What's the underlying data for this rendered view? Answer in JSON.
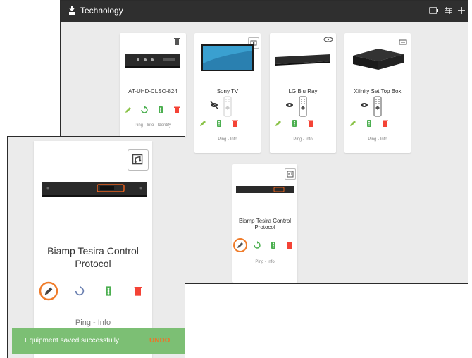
{
  "window": {
    "title": "Technology"
  },
  "equipment": [
    {
      "name": "AT-UHD-CLSO-824",
      "links": "Ping - Info - Identify",
      "badge_icon": "trash-icon"
    },
    {
      "name": "Sony TV",
      "links": "Ping - Info",
      "badge_icon": "play-box-icon"
    },
    {
      "name": "LG Blu Ray",
      "links": "Ping - Info",
      "badge_icon": "disc-player-icon"
    },
    {
      "name": "Xfinity Set Top Box",
      "links": "Ping - Info",
      "badge_icon": "set-top-box-icon"
    },
    {
      "name": "Biamp Tesira Control Protocol",
      "links": "Ping - Info",
      "badge_icon": "audio-processor-icon"
    }
  ],
  "detail": {
    "name_line1": "Biamp Tesira Control",
    "name_line2": "Protocol",
    "links": "Ping - Info"
  },
  "toast": {
    "message": "Equipment saved successfully",
    "action": "UNDO"
  },
  "colors": {
    "topbar": "#2f2f2f",
    "edit": "#8bc34a",
    "refresh": "#4caf50",
    "traffic": "#4caf50",
    "delete": "#f44336",
    "highlight": "#f07c2a",
    "toast": "#7cbf74"
  }
}
